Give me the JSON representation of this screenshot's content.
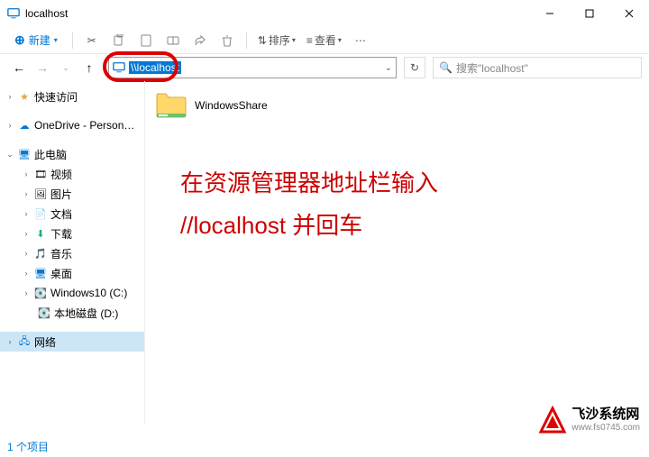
{
  "titlebar": {
    "title": "localhost"
  },
  "toolbar": {
    "new_label": "新建",
    "sort_label": "排序",
    "view_label": "查看"
  },
  "addressbar": {
    "value": "\\\\localhost",
    "search_placeholder": "搜索\"localhost\""
  },
  "sidebar": {
    "quick": "快速访问",
    "onedrive": "OneDrive - Person…",
    "thispc": "此电脑",
    "videos": "视频",
    "pictures": "图片",
    "documents": "文档",
    "downloads": "下载",
    "music": "音乐",
    "desktop": "桌面",
    "cdrive": "Windows10 (C:)",
    "ddrive": "本地磁盘 (D:)",
    "network": "网络"
  },
  "content": {
    "folder1": "WindowsShare"
  },
  "annotation": {
    "line1": "在资源管理器地址栏输入",
    "line2": "//localhost   并回车"
  },
  "statusbar": {
    "count": "1 个项目"
  },
  "watermark": {
    "title": "飞沙系统网",
    "url": "www.fs0745.com"
  }
}
